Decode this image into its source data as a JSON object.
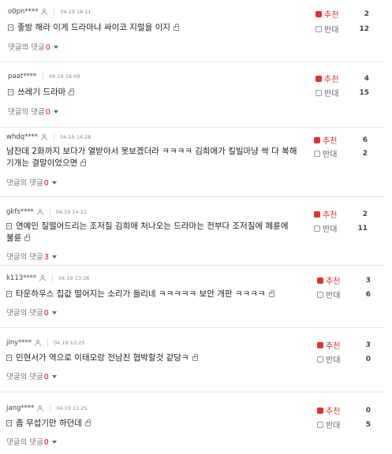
{
  "labels": {
    "recommend": "추천",
    "oppose": "반대",
    "reply_prefix": "댓글의 댓글"
  },
  "comments": [
    {
      "user": "o0pn****",
      "date": "04.19 16:11",
      "text": "좋방 해라 이게 드라마냐 싸이코 지럴을 이지",
      "replies": "0",
      "up": "2",
      "down": "12"
    },
    {
      "user": "paat****",
      "date": "04.19 16:09",
      "text": "쓰레기 드라마",
      "replies": "0",
      "up": "4",
      "down": "15"
    },
    {
      "user": "whdq****",
      "date": "04.19 14:28",
      "text": "남잔데 2화까지 보다가 열받아서 못보겠더라 ㅋㅋㅋㅋ 김희애가 킬빌마냥 싹 다 복해기개는 결말이었으면",
      "replies": "0",
      "up": "6",
      "down": "2"
    },
    {
      "user": "gkfs****",
      "date": "04.19 14:21",
      "text": "연예인 질떨어드리는 조저질 김희애 처나오는 드라마는 전부다 조저질에 페륜에 불륜",
      "replies": "3",
      "up": "2",
      "down": "11"
    },
    {
      "user": "k113****",
      "date": "04.19 13:26",
      "text": "타운하우스 집값 떨어지는 소리가 들리네 ㅋㅋㅋㅋㅋ 보안 개판 ㅋㅋㅋㅋ",
      "replies": "0",
      "up": "3",
      "down": "6"
    },
    {
      "user": "jiny****",
      "date": "04.19 13:25",
      "text": "민현서가 역으로 이태오랑 전남친 협박할것 같당ㅋ",
      "replies": "0",
      "up": "3",
      "down": "0"
    },
    {
      "user": "jang****",
      "date": "04.19 13:25",
      "text": "좀 무섭기만 하던데",
      "replies": "0",
      "up": "0",
      "down": "5"
    }
  ]
}
